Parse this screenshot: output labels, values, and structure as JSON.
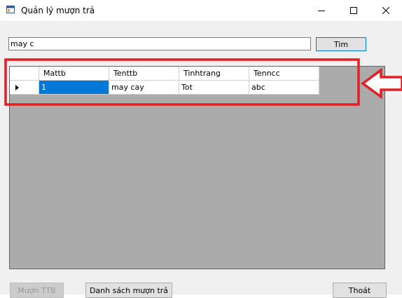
{
  "window": {
    "title": "Quản lý mượn trả"
  },
  "search": {
    "value": "may c",
    "button_label": "Tim"
  },
  "table": {
    "columns": [
      "Mattb",
      "Tenttb",
      "Tinhtrang",
      "Tenncc"
    ],
    "rows": [
      {
        "cells": [
          "1",
          "may cay",
          "Tot",
          "abc"
        ]
      }
    ],
    "selected_cell": "Mattb"
  },
  "footer": {
    "borrow_label": "Mượn TTB",
    "list_label": "Danh sách mượn trả",
    "exit_label": "Thoát"
  },
  "annotation": {
    "color": "#e31e24"
  },
  "icons": {
    "app": "app-form-icon",
    "minimize": "minimize-icon",
    "maximize": "maximize-icon",
    "close": "close-icon"
  }
}
